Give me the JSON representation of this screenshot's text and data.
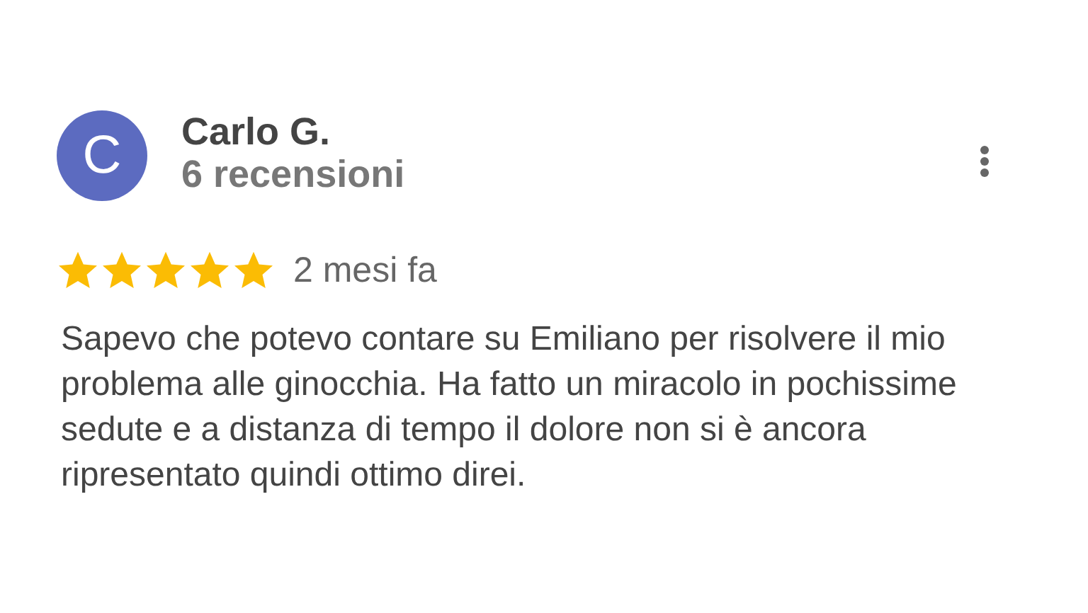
{
  "review": {
    "avatar_letter": "C",
    "author": "Carlo G.",
    "review_count": "6 recensioni",
    "stars": 5,
    "time": "2 mesi fa",
    "text": "Sapevo che potevo contare su Emiliano per risolvere il mio problema alle ginocchia. Ha fatto un miracolo in pochissime sedute e a distanza di tempo il dolore non si è ancora ripresentato quindi ottimo direi."
  }
}
